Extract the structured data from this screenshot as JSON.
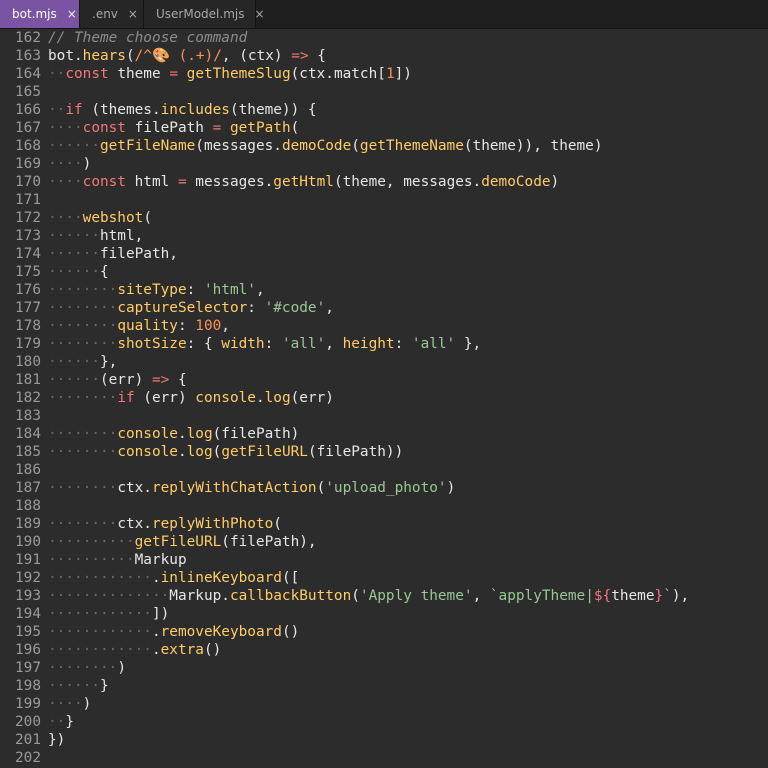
{
  "tabs": [
    {
      "label": "bot.mjs",
      "active": true
    },
    {
      "label": ".env",
      "active": false
    },
    {
      "label": "UserModel.mjs",
      "active": false
    }
  ],
  "close_glyph": "×",
  "lines": [
    {
      "n": "162",
      "t": [
        [
          "c",
          "// Theme choose command"
        ]
      ]
    },
    {
      "n": "163",
      "t": [
        [
          "p",
          "bot."
        ],
        [
          "f",
          "hears"
        ],
        [
          "p",
          "("
        ],
        [
          "r",
          "/^🎨 (.+)/"
        ],
        [
          "p",
          ", (ctx) "
        ],
        [
          "k",
          "=>"
        ],
        [
          "p",
          " {"
        ]
      ]
    },
    {
      "n": "164",
      "t": [
        [
          "ws",
          "··"
        ],
        [
          "k",
          "const"
        ],
        [
          "p",
          " theme "
        ],
        [
          "k",
          "="
        ],
        [
          "p",
          " "
        ],
        [
          "f",
          "getThemeSlug"
        ],
        [
          "p",
          "(ctx.match["
        ],
        [
          "n",
          "1"
        ],
        [
          "p",
          "])"
        ]
      ]
    },
    {
      "n": "165",
      "t": []
    },
    {
      "n": "166",
      "t": [
        [
          "ws",
          "··"
        ],
        [
          "k",
          "if"
        ],
        [
          "p",
          " (themes."
        ],
        [
          "f",
          "includes"
        ],
        [
          "p",
          "(theme)) {"
        ]
      ]
    },
    {
      "n": "167",
      "t": [
        [
          "ws",
          "····"
        ],
        [
          "k",
          "const"
        ],
        [
          "p",
          " filePath "
        ],
        [
          "k",
          "="
        ],
        [
          "p",
          " "
        ],
        [
          "f",
          "getPath"
        ],
        [
          "p",
          "("
        ]
      ]
    },
    {
      "n": "168",
      "t": [
        [
          "ws",
          "······"
        ],
        [
          "f",
          "getFileName"
        ],
        [
          "p",
          "(messages."
        ],
        [
          "f",
          "demoCode"
        ],
        [
          "p",
          "("
        ],
        [
          "f",
          "getThemeName"
        ],
        [
          "p",
          "(theme)), theme)"
        ]
      ]
    },
    {
      "n": "169",
      "t": [
        [
          "ws",
          "····"
        ],
        [
          "p",
          ")"
        ]
      ]
    },
    {
      "n": "170",
      "t": [
        [
          "ws",
          "····"
        ],
        [
          "k",
          "const"
        ],
        [
          "p",
          " html "
        ],
        [
          "k",
          "="
        ],
        [
          "p",
          " messages."
        ],
        [
          "f",
          "getHtml"
        ],
        [
          "p",
          "(theme, messages."
        ],
        [
          "f",
          "demoCode"
        ],
        [
          "p",
          ")"
        ]
      ]
    },
    {
      "n": "171",
      "t": []
    },
    {
      "n": "172",
      "t": [
        [
          "ws",
          "····"
        ],
        [
          "f",
          "webshot"
        ],
        [
          "p",
          "("
        ]
      ]
    },
    {
      "n": "173",
      "t": [
        [
          "ws",
          "······"
        ],
        [
          "p",
          "html,"
        ]
      ]
    },
    {
      "n": "174",
      "t": [
        [
          "ws",
          "······"
        ],
        [
          "p",
          "filePath,"
        ]
      ]
    },
    {
      "n": "175",
      "t": [
        [
          "ws",
          "······"
        ],
        [
          "p",
          "{"
        ]
      ]
    },
    {
      "n": "176",
      "t": [
        [
          "ws",
          "········"
        ],
        [
          "f",
          "siteType"
        ],
        [
          "p",
          ": "
        ],
        [
          "s",
          "'html'"
        ],
        [
          "p",
          ","
        ]
      ]
    },
    {
      "n": "177",
      "t": [
        [
          "ws",
          "········"
        ],
        [
          "f",
          "captureSelector"
        ],
        [
          "p",
          ": "
        ],
        [
          "s",
          "'#code'"
        ],
        [
          "p",
          ","
        ]
      ]
    },
    {
      "n": "178",
      "t": [
        [
          "ws",
          "········"
        ],
        [
          "f",
          "quality"
        ],
        [
          "p",
          ": "
        ],
        [
          "n",
          "100"
        ],
        [
          "p",
          ","
        ]
      ]
    },
    {
      "n": "179",
      "t": [
        [
          "ws",
          "········"
        ],
        [
          "f",
          "shotSize"
        ],
        [
          "p",
          ": { "
        ],
        [
          "f",
          "width"
        ],
        [
          "p",
          ": "
        ],
        [
          "s",
          "'all'"
        ],
        [
          "p",
          ", "
        ],
        [
          "f",
          "height"
        ],
        [
          "p",
          ": "
        ],
        [
          "s",
          "'all'"
        ],
        [
          "p",
          " },"
        ]
      ]
    },
    {
      "n": "180",
      "t": [
        [
          "ws",
          "······"
        ],
        [
          "p",
          "},"
        ]
      ]
    },
    {
      "n": "181",
      "t": [
        [
          "ws",
          "······"
        ],
        [
          "p",
          "(err) "
        ],
        [
          "k",
          "=>"
        ],
        [
          "p",
          " {"
        ]
      ]
    },
    {
      "n": "182",
      "t": [
        [
          "ws",
          "········"
        ],
        [
          "k",
          "if"
        ],
        [
          "p",
          " (err) "
        ],
        [
          "f",
          "console"
        ],
        [
          "p",
          "."
        ],
        [
          "f",
          "log"
        ],
        [
          "p",
          "(err)"
        ]
      ]
    },
    {
      "n": "183",
      "t": []
    },
    {
      "n": "184",
      "t": [
        [
          "ws",
          "········"
        ],
        [
          "f",
          "console"
        ],
        [
          "p",
          "."
        ],
        [
          "f",
          "log"
        ],
        [
          "p",
          "(filePath)"
        ]
      ]
    },
    {
      "n": "185",
      "t": [
        [
          "ws",
          "········"
        ],
        [
          "f",
          "console"
        ],
        [
          "p",
          "."
        ],
        [
          "f",
          "log"
        ],
        [
          "p",
          "("
        ],
        [
          "f",
          "getFileURL"
        ],
        [
          "p",
          "(filePath))"
        ]
      ]
    },
    {
      "n": "186",
      "t": []
    },
    {
      "n": "187",
      "t": [
        [
          "ws",
          "········"
        ],
        [
          "p",
          "ctx."
        ],
        [
          "f",
          "replyWithChatAction"
        ],
        [
          "p",
          "("
        ],
        [
          "s",
          "'upload_photo'"
        ],
        [
          "p",
          ")"
        ]
      ]
    },
    {
      "n": "188",
      "t": []
    },
    {
      "n": "189",
      "t": [
        [
          "ws",
          "········"
        ],
        [
          "p",
          "ctx."
        ],
        [
          "f",
          "replyWithPhoto"
        ],
        [
          "p",
          "("
        ]
      ]
    },
    {
      "n": "190",
      "t": [
        [
          "ws",
          "··········"
        ],
        [
          "f",
          "getFileURL"
        ],
        [
          "p",
          "(filePath),"
        ]
      ]
    },
    {
      "n": "191",
      "t": [
        [
          "ws",
          "··········"
        ],
        [
          "p",
          "Markup"
        ]
      ]
    },
    {
      "n": "192",
      "t": [
        [
          "ws",
          "············"
        ],
        [
          "p",
          "."
        ],
        [
          "f",
          "inlineKeyboard"
        ],
        [
          "p",
          "(["
        ]
      ]
    },
    {
      "n": "193",
      "t": [
        [
          "ws",
          "··············"
        ],
        [
          "p",
          "Markup."
        ],
        [
          "f",
          "callbackButton"
        ],
        [
          "p",
          "("
        ],
        [
          "s",
          "'Apply theme'"
        ],
        [
          "p",
          ", "
        ],
        [
          "s",
          "`applyTheme|"
        ],
        [
          "k",
          "${"
        ],
        [
          "p",
          "theme"
        ],
        [
          "k",
          "}"
        ],
        [
          "s",
          "`"
        ],
        [
          "p",
          "),"
        ]
      ]
    },
    {
      "n": "194",
      "t": [
        [
          "ws",
          "············"
        ],
        [
          "p",
          "])"
        ]
      ]
    },
    {
      "n": "195",
      "t": [
        [
          "ws",
          "············"
        ],
        [
          "p",
          "."
        ],
        [
          "f",
          "removeKeyboard"
        ],
        [
          "p",
          "()"
        ]
      ]
    },
    {
      "n": "196",
      "t": [
        [
          "ws",
          "············"
        ],
        [
          "p",
          "."
        ],
        [
          "f",
          "extra"
        ],
        [
          "p",
          "()"
        ]
      ]
    },
    {
      "n": "197",
      "t": [
        [
          "ws",
          "········"
        ],
        [
          "p",
          ")"
        ]
      ]
    },
    {
      "n": "198",
      "t": [
        [
          "ws",
          "······"
        ],
        [
          "p",
          "}"
        ]
      ]
    },
    {
      "n": "199",
      "t": [
        [
          "ws",
          "····"
        ],
        [
          "p",
          ")"
        ]
      ]
    },
    {
      "n": "200",
      "t": [
        [
          "ws",
          "··"
        ],
        [
          "p",
          "}"
        ]
      ]
    },
    {
      "n": "201",
      "t": [
        [
          "p",
          "})"
        ]
      ]
    },
    {
      "n": "202",
      "t": []
    }
  ]
}
